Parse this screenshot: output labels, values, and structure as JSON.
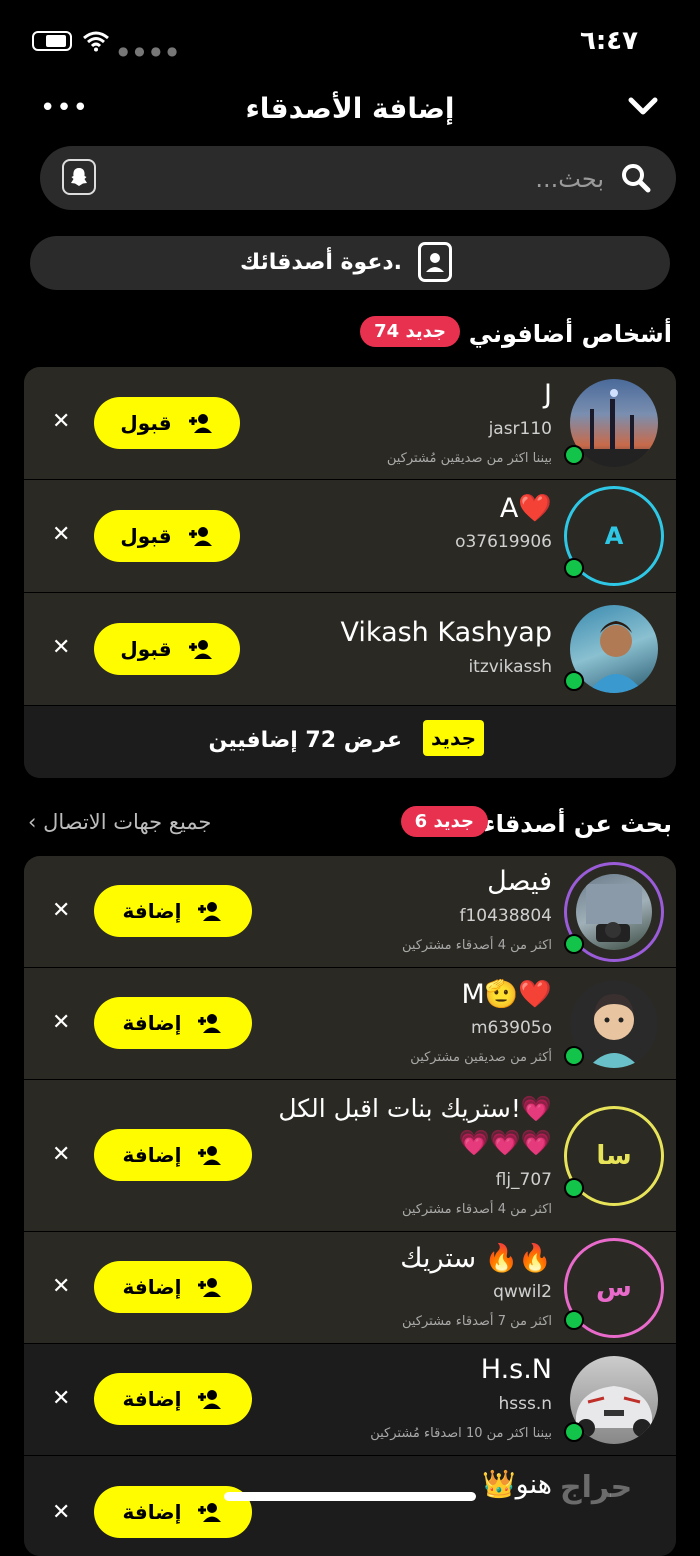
{
  "status": {
    "time": "٦:٤٧"
  },
  "header": {
    "title": "إضافة الأصدقاء",
    "more_label": "•••"
  },
  "search": {
    "placeholder": "بحث..."
  },
  "invite": {
    "label": "دعوة أصدقائك."
  },
  "added_me": {
    "title": "أشخاص أضافوني",
    "badge": "74 جديد",
    "action_label": "قبول",
    "items": [
      {
        "name": "J",
        "handle": "jasr110",
        "mutual": "بيننا اكثر من صديقين مُشتركين",
        "ring": "",
        "avatar": "night-city"
      },
      {
        "name": "A❤️",
        "handle": "o37619906",
        "mutual": "",
        "ring": "#2ec8e6",
        "avatar_letter": "A"
      },
      {
        "name": "Vikash Kashyap",
        "handle": "itzvikassh",
        "mutual": "",
        "ring": "",
        "avatar": "selfie"
      }
    ],
    "more": {
      "new_label": "جديد",
      "text": "عرض 72 إضافيين"
    }
  },
  "find_friends": {
    "title": "بحث عن أصدقاء",
    "badge": "6 جديد",
    "all_contacts": "جميع جهات الاتصال",
    "action_label": "إضافة",
    "items": [
      {
        "name": "فيصل",
        "name2": "",
        "handle": "f10438804",
        "mutual": "اكثر من 4 أصدقاء مشتركين",
        "ring": "#9a5cd8"
      },
      {
        "name": "M🫡❤️",
        "name2": "",
        "handle": "m63905o",
        "mutual": "أكثر من صديقين مشتركين",
        "ring": ""
      },
      {
        "name": "ستريك بنات اقبل الكل!💗",
        "name2": "💗💗💗",
        "handle": "flj_707",
        "mutual": "اكثر من 4 أصدقاء مشتركين",
        "ring": "#e8e45a",
        "avatar_letter": "سا"
      },
      {
        "name": "ستريك 🔥🔥",
        "name2": "",
        "handle": "qwwil2",
        "mutual": "اكثر من 7 أصدقاء مشتركين",
        "ring": "#e86acb",
        "avatar_letter": "س"
      },
      {
        "name": "H.s.N",
        "name2": "",
        "handle": "hsss.n",
        "mutual": "بيننا اكثر من 10 اصدقاء مُشتركين",
        "ring": ""
      },
      {
        "name": "👑هنو",
        "name2": "",
        "handle": "",
        "mutual": "",
        "ring": ""
      }
    ]
  },
  "colors": {
    "accent": "#fffc00",
    "badge": "#e8314f",
    "online": "#12c449",
    "row_bg": "#2a2923"
  },
  "watermark": "حراج"
}
